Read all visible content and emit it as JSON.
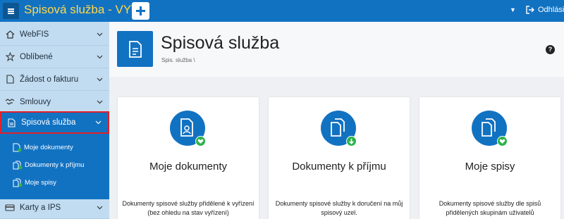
{
  "topbar": {
    "app_title": "Spisová služba - VYV",
    "logout_label": "Odhlásit",
    "colors": {
      "bar": "#1272c2",
      "title": "#ffd84a"
    }
  },
  "sidebar": {
    "items": [
      {
        "label": "WebFIS",
        "icon": "home-icon"
      },
      {
        "label": "Oblíbené",
        "icon": "star-icon"
      },
      {
        "label": "Žádost o fakturu",
        "icon": "document-icon"
      },
      {
        "label": "Smlouvy",
        "icon": "handshake-icon"
      },
      {
        "label": "Spisová služba",
        "icon": "document-icon",
        "active": true
      },
      {
        "label": "Karty a IPS",
        "icon": "card-icon"
      }
    ],
    "submenu": [
      {
        "label": "Moje dokumenty",
        "icon": "document-user-icon"
      },
      {
        "label": "Dokumenty k příjmu",
        "icon": "documents-icon"
      },
      {
        "label": "Moje spisy",
        "icon": "documents-icon"
      }
    ]
  },
  "header": {
    "title": "Spisová služba",
    "breadcrumb": "Spis. služba  \\",
    "help_label": "?"
  },
  "cards": [
    {
      "title": "Moje dokumenty",
      "description": "Dokumenty spisové služby přidělené k vyřízení (bez ohledu na stav vyřízení)",
      "icon": "document-user-icon",
      "badge": "heart-icon"
    },
    {
      "title": "Dokumenty k příjmu",
      "description": "Dokumenty spisové služby k doručení na můj spisový uzel.",
      "icon": "documents-icon",
      "badge": "arrow-down-icon"
    },
    {
      "title": "Moje spisy",
      "description": "Dokumenty spisové služby dle spisů přidělených skupinám uživatelů",
      "icon": "documents-icon",
      "badge": "heart-icon"
    }
  ]
}
